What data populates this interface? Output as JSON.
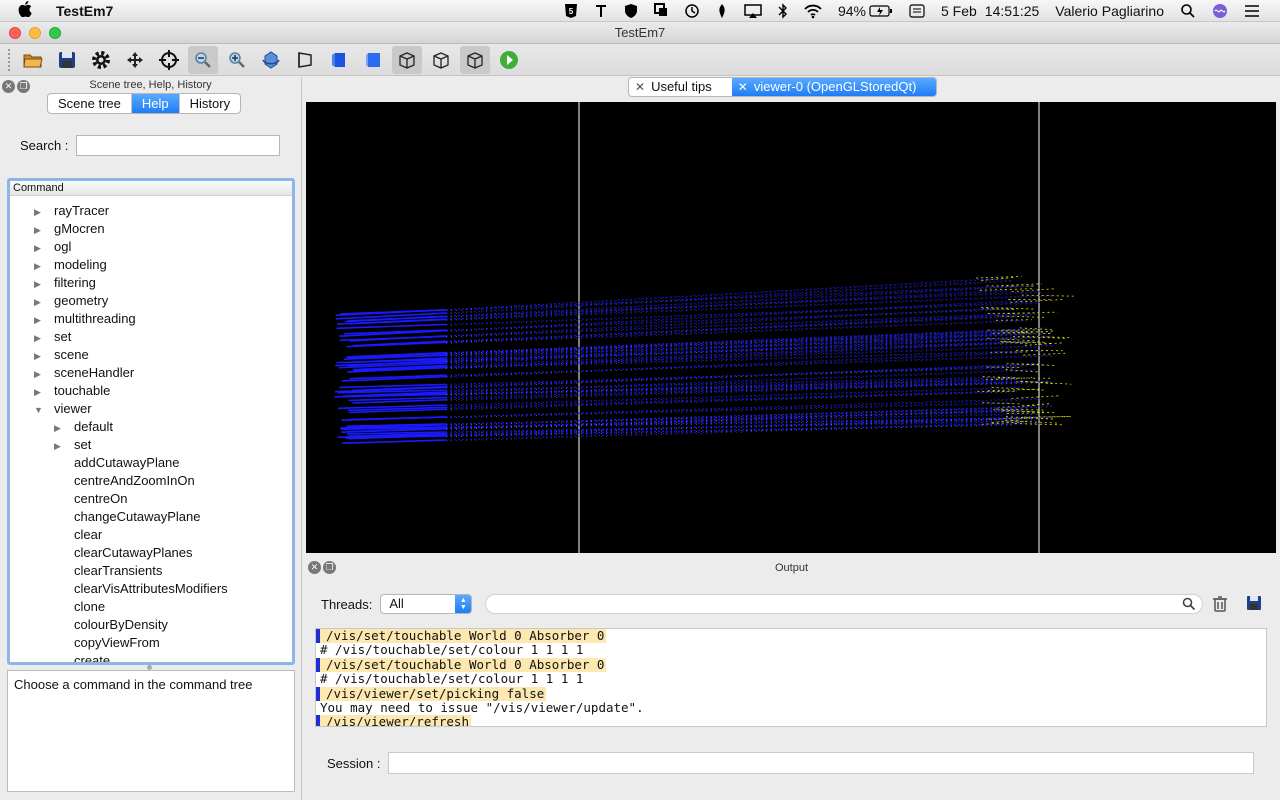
{
  "menubar": {
    "app_name": "TestEm7",
    "battery": "94%",
    "date": "5 Feb",
    "time": "14:51:25",
    "user": "Valerio Pagliarino"
  },
  "window": {
    "title": "TestEm7"
  },
  "toolbar": {
    "icons": [
      "open-folder-icon",
      "save-icon",
      "gear-icon",
      "move-icon",
      "crosshair-icon",
      "zoom-out-icon",
      "zoom-in-icon",
      "rotate-icon",
      "perspective-icon",
      "solid-icon",
      "hidden-line-icon",
      "wireframe-icon",
      "hidden-surface-icon",
      "surface-icon",
      "run-icon"
    ]
  },
  "left_dock": {
    "title": "Scene tree, Help, History",
    "tabs": [
      "Scene tree",
      "Help",
      "History"
    ],
    "selected_tab": "Help",
    "search_label": "Search :",
    "search_value": "",
    "tree_header": "Command",
    "tree_items": [
      {
        "label": "rayTracer",
        "level": 0,
        "expandable": true,
        "expanded": false
      },
      {
        "label": "gMocren",
        "level": 0,
        "expandable": true,
        "expanded": false
      },
      {
        "label": "ogl",
        "level": 0,
        "expandable": true,
        "expanded": false
      },
      {
        "label": "modeling",
        "level": 0,
        "expandable": true,
        "expanded": false
      },
      {
        "label": "filtering",
        "level": 0,
        "expandable": true,
        "expanded": false
      },
      {
        "label": "geometry",
        "level": 0,
        "expandable": true,
        "expanded": false
      },
      {
        "label": "multithreading",
        "level": 0,
        "expandable": true,
        "expanded": false
      },
      {
        "label": "set",
        "level": 0,
        "expandable": true,
        "expanded": false
      },
      {
        "label": "scene",
        "level": 0,
        "expandable": true,
        "expanded": false
      },
      {
        "label": "sceneHandler",
        "level": 0,
        "expandable": true,
        "expanded": false
      },
      {
        "label": "touchable",
        "level": 0,
        "expandable": true,
        "expanded": false
      },
      {
        "label": "viewer",
        "level": 0,
        "expandable": true,
        "expanded": true
      },
      {
        "label": "default",
        "level": 1,
        "expandable": true,
        "expanded": false
      },
      {
        "label": "set",
        "level": 1,
        "expandable": true,
        "expanded": false
      },
      {
        "label": "addCutawayPlane",
        "level": 1,
        "expandable": false
      },
      {
        "label": "centreAndZoomInOn",
        "level": 1,
        "expandable": false
      },
      {
        "label": "centreOn",
        "level": 1,
        "expandable": false
      },
      {
        "label": "changeCutawayPlane",
        "level": 1,
        "expandable": false
      },
      {
        "label": "clear",
        "level": 1,
        "expandable": false
      },
      {
        "label": "clearCutawayPlanes",
        "level": 1,
        "expandable": false
      },
      {
        "label": "clearTransients",
        "level": 1,
        "expandable": false
      },
      {
        "label": "clearVisAttributesModifiers",
        "level": 1,
        "expandable": false
      },
      {
        "label": "clone",
        "level": 1,
        "expandable": false
      },
      {
        "label": "colourByDensity",
        "level": 1,
        "expandable": false
      },
      {
        "label": "copyViewFrom",
        "level": 1,
        "expandable": false
      },
      {
        "label": "create",
        "level": 1,
        "expandable": false
      }
    ],
    "description": "Choose a command in the command tree"
  },
  "viewer_tabs": [
    {
      "label": "Useful tips",
      "selected": false
    },
    {
      "label": "viewer-0 (OpenGLStoredQt)",
      "selected": true
    }
  ],
  "viewer": {
    "background": "#000000",
    "track_color_primary": "#1a1aff",
    "track_color_secondary": "#e6e600",
    "detector_line_color": "#ffffff"
  },
  "output": {
    "title": "Output",
    "threads_label": "Threads:",
    "threads_value": "All",
    "filter_value": "",
    "lines": [
      {
        "text": "/vis/set/touchable World 0 Absorber 0",
        "cmd": true
      },
      {
        "text": "# /vis/touchable/set/colour 1 1 1 1",
        "cmd": false
      },
      {
        "text": "/vis/set/touchable World 0 Absorber 0",
        "cmd": true
      },
      {
        "text": "# /vis/touchable/set/colour 1 1 1 1",
        "cmd": false
      },
      {
        "text": "/vis/viewer/set/picking false",
        "cmd": true
      },
      {
        "text": "You may need to issue \"/vis/viewer/update\".",
        "cmd": false
      },
      {
        "text": "/vis/viewer/refresh",
        "cmd": true
      }
    ],
    "session_label": "Session :",
    "session_value": ""
  }
}
